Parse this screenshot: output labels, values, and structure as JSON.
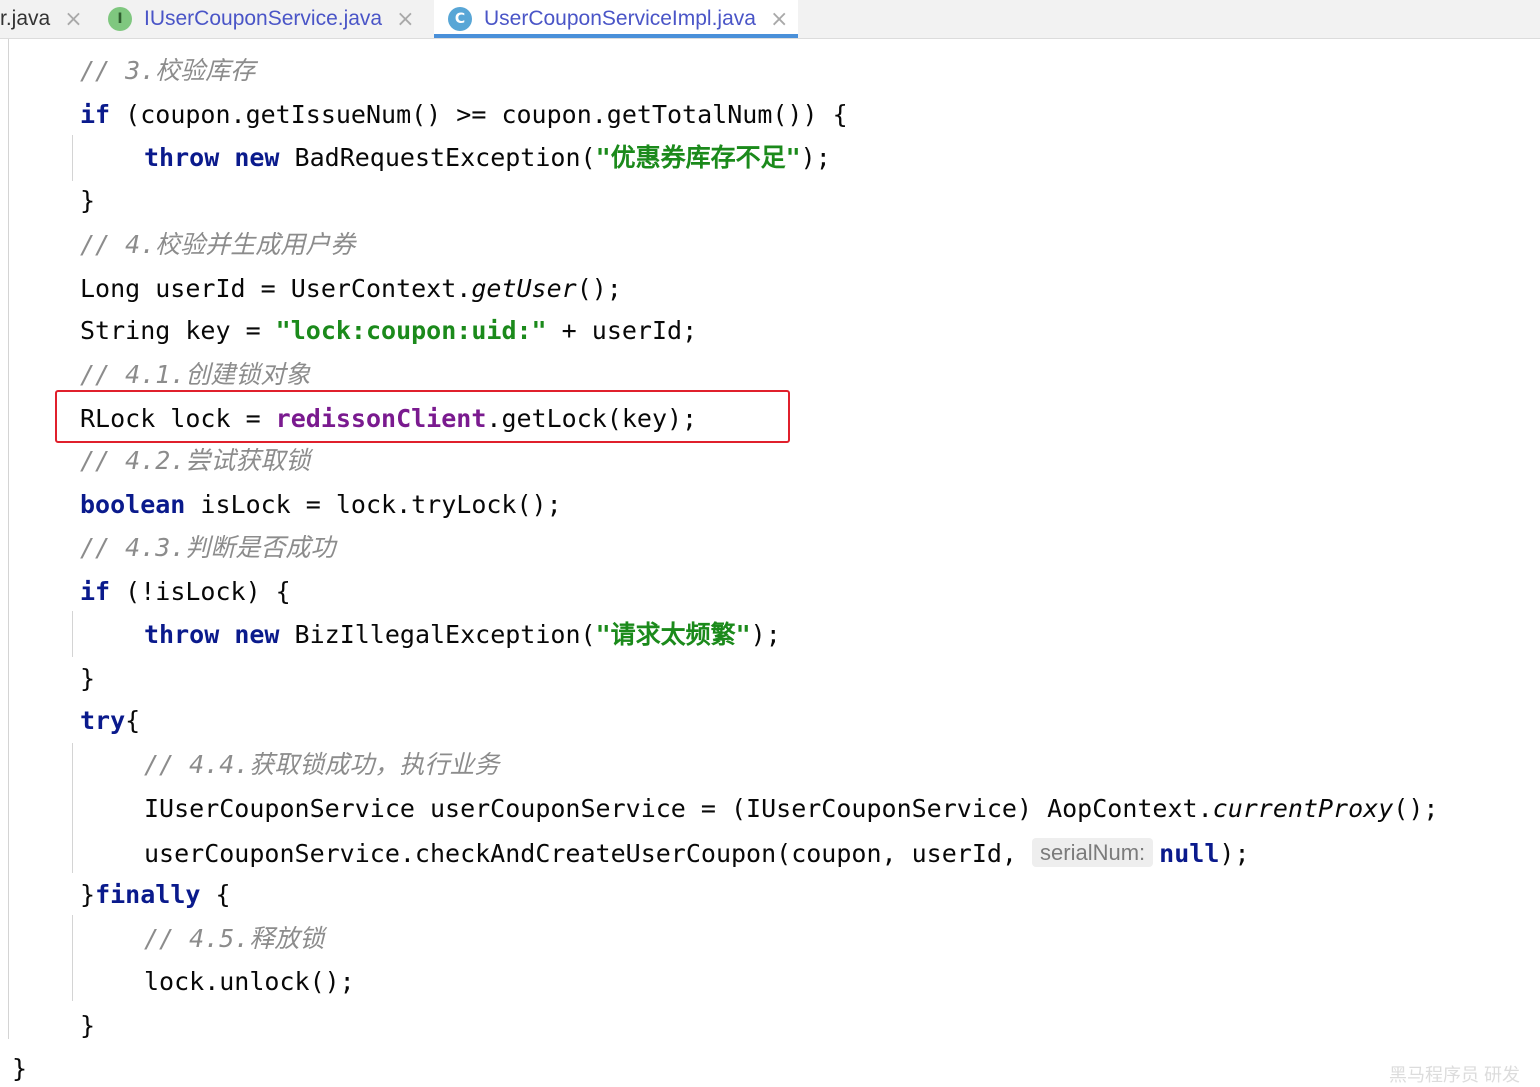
{
  "tabs": [
    {
      "label": "r.java",
      "close": "×"
    },
    {
      "label": "IUserCouponService.java",
      "icon_letter": "I",
      "close": "×"
    },
    {
      "label": "UserCouponServiceImpl.java",
      "icon_letter": "C",
      "close": "×",
      "active": true
    }
  ],
  "code": {
    "l1": "// 3.校验库存",
    "l2": {
      "kw": "if",
      "text": " (coupon.getIssueNum() >= coupon.getTotalNum()) {"
    },
    "l3": {
      "kw1": "throw",
      "kw2": "new",
      "text": " BadRequestException(",
      "str": "\"优惠券库存不足\"",
      "end": ");"
    },
    "l4": "}",
    "l5": "// 4.校验并生成用户券",
    "l6": {
      "text": "Long userId = UserContext.",
      "ital": "getUser",
      "end": "();"
    },
    "l7": {
      "text": "String key = ",
      "str": "\"lock:coupon:uid:\"",
      "end": " + userId;"
    },
    "l8": "// 4.1.创建锁对象",
    "l9": {
      "text": "RLock lock = ",
      "field": "redissonClient",
      "end": ".getLock(key);"
    },
    "l10": "// 4.2.尝试获取锁",
    "l11": {
      "kw": "boolean",
      "text": " isLock = lock.tryLock();"
    },
    "l12": "// 4.3.判断是否成功",
    "l13": {
      "kw": "if",
      "text": " (!isLock) {"
    },
    "l14": {
      "kw1": "throw",
      "kw2": "new",
      "text": " BizIllegalException(",
      "str": "\"请求太频繁\"",
      "end": ");"
    },
    "l15": "}",
    "l16": {
      "kw": "try",
      "text": "{"
    },
    "l17": "// 4.4.获取锁成功，执行业务",
    "l18": {
      "text": "IUserCouponService userCouponService = (IUserCouponService) AopContext.",
      "ital": "currentProxy",
      "end": "();"
    },
    "l19": {
      "text": "userCouponService.checkAndCreateUserCoupon(coupon, userId, ",
      "hint": "serialNum:",
      "kw": "null",
      "end": ");"
    },
    "l20": {
      "pre": "}",
      "kw": "finally",
      "text": " {"
    },
    "l21": "// 4.5.释放锁",
    "l22": "lock.unlock();",
    "l23": "}",
    "l24": "}"
  },
  "watermark": "黑马程序员 研发"
}
